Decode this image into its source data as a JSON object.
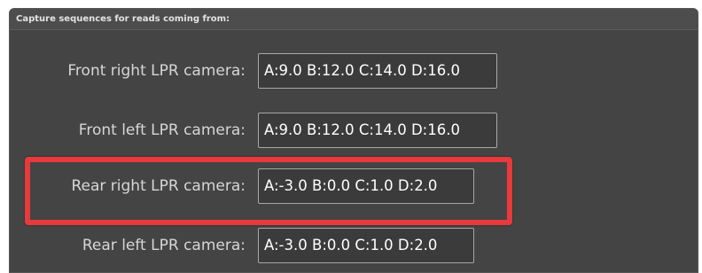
{
  "group": {
    "title": "Capture sequences for reads coming from:",
    "rows": [
      {
        "label": "Front right LPR camera:",
        "value": "A:9.0 B:12.0 C:14.0 D:16.0"
      },
      {
        "label": "Front left LPR camera:",
        "value": "A:9.0 B:12.0 C:14.0 D:16.0"
      },
      {
        "label": "Rear right LPR camera:",
        "value": "A:-3.0 B:0.0 C:1.0 D:2.0"
      },
      {
        "label": "Rear left LPR camera:",
        "value": "A:-3.0 B:0.0 C:1.0 D:2.0"
      }
    ]
  },
  "highlight": {
    "color": "#e8393c",
    "target": "Rear right LPR camera"
  }
}
